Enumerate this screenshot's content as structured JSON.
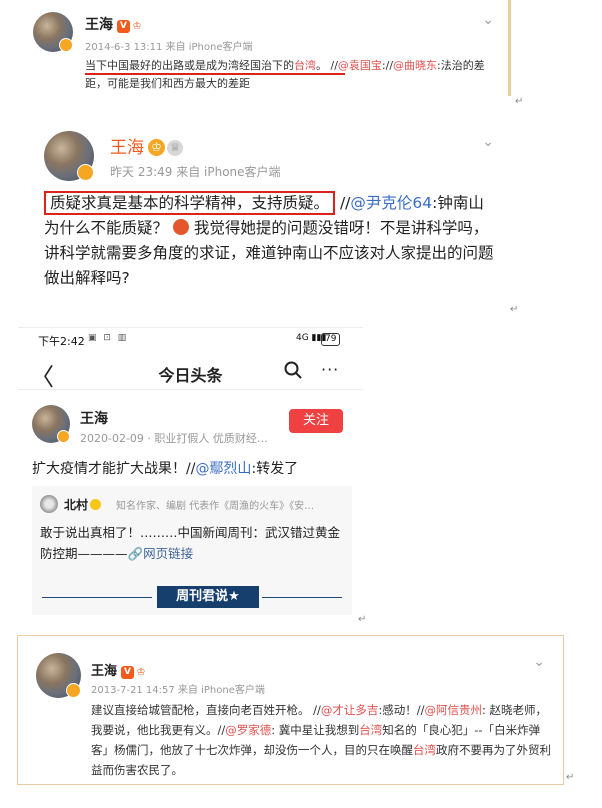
{
  "post1": {
    "name": "王海",
    "vip": "V",
    "crown": "♔",
    "meta": "2014-6-3 13:11 来自 iPhone客户端",
    "text_a": "当下中国最好的出路或是成为",
    "text_b": "湾经国治下的",
    "text_c": "台湾",
    "text_d": "。  //",
    "mention1": "@袁国宝",
    "text_e": "://",
    "mention2": "@曲晓东",
    "text_f": ":法治的差距，可能是我们和西方最大的差距",
    "chevron": "⌄"
  },
  "post2": {
    "name": "王海",
    "crown": "♔",
    "crown2": "♕",
    "meta": "昨天 23:49  来自 iPhone客户端",
    "boxed": "质疑求真是基本的科学精神，支持质疑。",
    "slashes": "//",
    "mention": "@尹克伦64",
    "text_a": ":钟南山为什么不能质疑？",
    "text_b": "我觉得她提的问题没错呀！不是讲科学吗，讲科学就需要多角度的求证，难道钟南山不应该对人家提出的问题做出解释吗?",
    "chevron": "⌄"
  },
  "post3": {
    "status_time": "下午2:42",
    "status_icons": "▣ ⊡ ▥",
    "status_signal": "4G ▮▮▮",
    "status_battery": "79",
    "back": "〈",
    "nav_title": "今日头条",
    "search_icon": "○",
    "more_icon": "···",
    "name": "王海",
    "meta": "2020-02-09 · 职业打假人 优质财经…",
    "follow": "关注",
    "body_a": "扩大疫情才能扩大战果！//",
    "body_mention": "@鄢烈山",
    "body_b": ":转发了",
    "quote_name": "北村",
    "quote_meta": "知名作家、编剧 代表作《周渔的火车》《安…",
    "quote_text": "敢于说出真相了！………中国新闻周刊：武汉错过黄金防控期————",
    "quote_link": "🔗网页链接",
    "banner": "周刊君说★"
  },
  "post4": {
    "name": "王海",
    "vip": "V",
    "crown": "♔",
    "meta": "2013-7-21 14:57 来自 iPhone客户端",
    "text_a": "建议直接给城管配枪，直接向老百姓开枪。  //",
    "m1": "@才让多吉",
    "text_b": ":感动！//",
    "m2": "@阿信贵州",
    "text_c": ": 赵晓老师，我要说，他比我更有义。//",
    "m3": "@罗家德",
    "text_d": ": 冀中星让我想到",
    "t1": "台湾",
    "text_e": "知名的「良心犯」--「白米炸弹客」杨儒门，他放了十七次炸弹，却没伤一个人，目的只在唤醒",
    "t2": "台湾",
    "text_f": "政府不要再为了外贸利益而伤害农民了。",
    "chevron": "⌄"
  },
  "return_mark": "↵"
}
